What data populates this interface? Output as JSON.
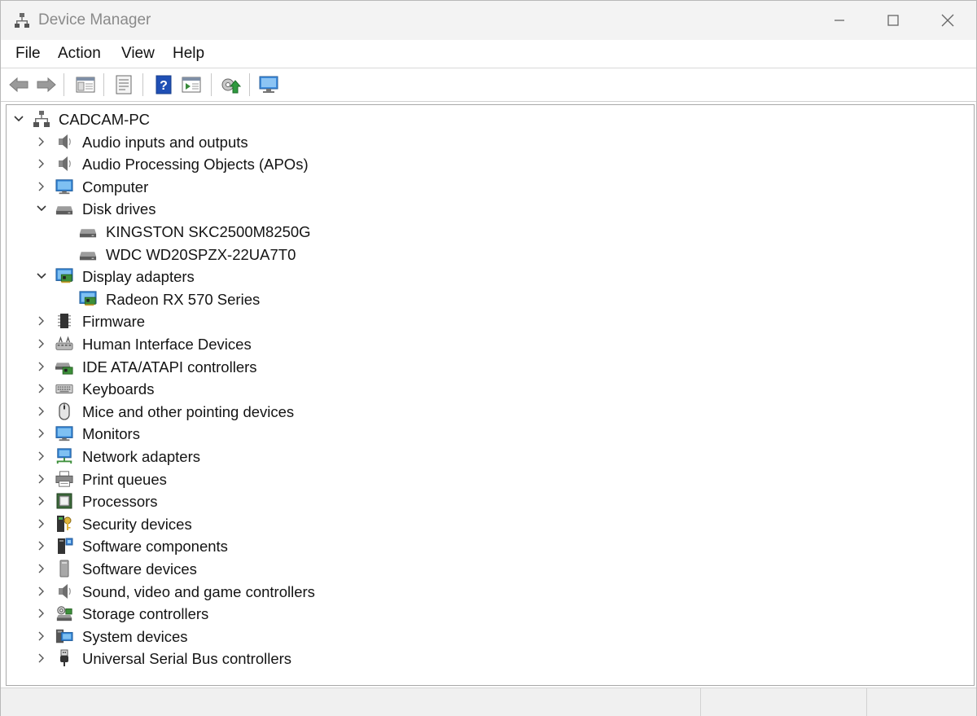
{
  "window": {
    "title": "Device Manager"
  },
  "menu": [
    "File",
    "Action",
    "View",
    "Help"
  ],
  "toolbar": {
    "buttons": [
      "back-icon",
      "forward-icon",
      "show-hide-console-tree-icon",
      "properties-icon",
      "help-icon",
      "action-pane-icon",
      "update-driver-icon",
      "scan-hardware-icon"
    ]
  },
  "tree": {
    "root": {
      "label": "CADCAM-PC",
      "expanded": true
    },
    "categories": [
      {
        "label": "Audio inputs and outputs",
        "icon": "speaker-icon",
        "expanded": false
      },
      {
        "label": "Audio Processing Objects (APOs)",
        "icon": "speaker-icon",
        "expanded": false
      },
      {
        "label": "Computer",
        "icon": "monitor-icon",
        "expanded": false
      },
      {
        "label": "Disk drives",
        "icon": "disk-drive-icon",
        "expanded": true,
        "children": [
          {
            "label": "KINGSTON SKC2500M8250G",
            "icon": "disk-drive-icon"
          },
          {
            "label": "WDC WD20SPZX-22UA7T0",
            "icon": "disk-drive-icon"
          }
        ]
      },
      {
        "label": "Display adapters",
        "icon": "display-adapter-icon",
        "expanded": true,
        "children": [
          {
            "label": "Radeon RX 570 Series",
            "icon": "display-adapter-icon"
          }
        ]
      },
      {
        "label": "Firmware",
        "icon": "firmware-icon",
        "expanded": false
      },
      {
        "label": "Human Interface Devices",
        "icon": "hid-icon",
        "expanded": false
      },
      {
        "label": "IDE ATA/ATAPI controllers",
        "icon": "ide-controller-icon",
        "expanded": false
      },
      {
        "label": "Keyboards",
        "icon": "keyboard-icon",
        "expanded": false
      },
      {
        "label": "Mice and other pointing devices",
        "icon": "mouse-icon",
        "expanded": false
      },
      {
        "label": "Monitors",
        "icon": "monitor-icon",
        "expanded": false
      },
      {
        "label": "Network adapters",
        "icon": "network-adapter-icon",
        "expanded": false
      },
      {
        "label": "Print queues",
        "icon": "printer-icon",
        "expanded": false
      },
      {
        "label": "Processors",
        "icon": "processor-icon",
        "expanded": false
      },
      {
        "label": "Security devices",
        "icon": "security-device-icon",
        "expanded": false
      },
      {
        "label": "Software components",
        "icon": "software-component-icon",
        "expanded": false
      },
      {
        "label": "Software devices",
        "icon": "software-device-icon",
        "expanded": false
      },
      {
        "label": "Sound, video and game controllers",
        "icon": "speaker-icon",
        "expanded": false
      },
      {
        "label": "Storage controllers",
        "icon": "storage-controller-icon",
        "expanded": false
      },
      {
        "label": "System devices",
        "icon": "system-device-icon",
        "expanded": false
      },
      {
        "label": "Universal Serial Bus controllers",
        "icon": "usb-icon",
        "expanded": false
      }
    ]
  }
}
